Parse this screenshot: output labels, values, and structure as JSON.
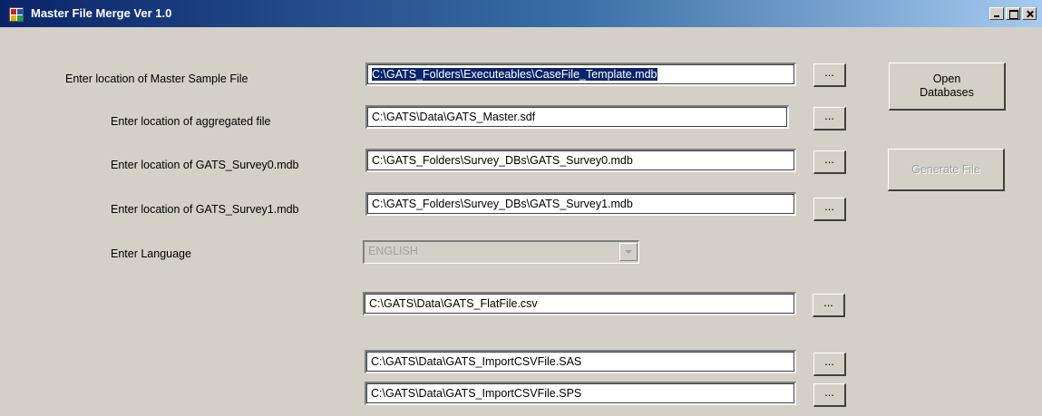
{
  "window": {
    "title": "Master File Merge  Ver 1.0"
  },
  "labels": {
    "master_sample": "Enter location of Master Sample File",
    "aggregated": "Enter location of aggregated file",
    "survey0": "Enter location of GATS_Survey0.mdb",
    "survey1": "Enter location of GATS_Survey1.mdb",
    "language": "Enter Language"
  },
  "fields": {
    "master_sample": "C:\\GATS_Folders\\Executeables\\CaseFile_Template.mdb",
    "aggregated": "C:\\GATS\\Data\\GATS_Master.sdf",
    "survey0": "C:\\GATS_Folders\\Survey_DBs\\GATS_Survey0.mdb",
    "survey1": "C:\\GATS_Folders\\Survey_DBs\\GATS_Survey1.mdb",
    "flatfile": "C:\\GATS\\Data\\GATS_FlatFile.csv",
    "sas": "C:\\GATS\\Data\\GATS_ImportCSVFile.SAS",
    "sps": "C:\\GATS\\Data\\GATS_ImportCSVFile.SPS"
  },
  "language": {
    "selected": "ENGLISH"
  },
  "buttons": {
    "browse": "...",
    "open_databases": "Open Databases",
    "generate_file": "Generate File"
  },
  "icons": {
    "app": "app-icon",
    "minimize": "minimize-icon",
    "maximize": "maximize-icon",
    "close": "close-icon",
    "dropdown": "chevron-down-icon"
  }
}
